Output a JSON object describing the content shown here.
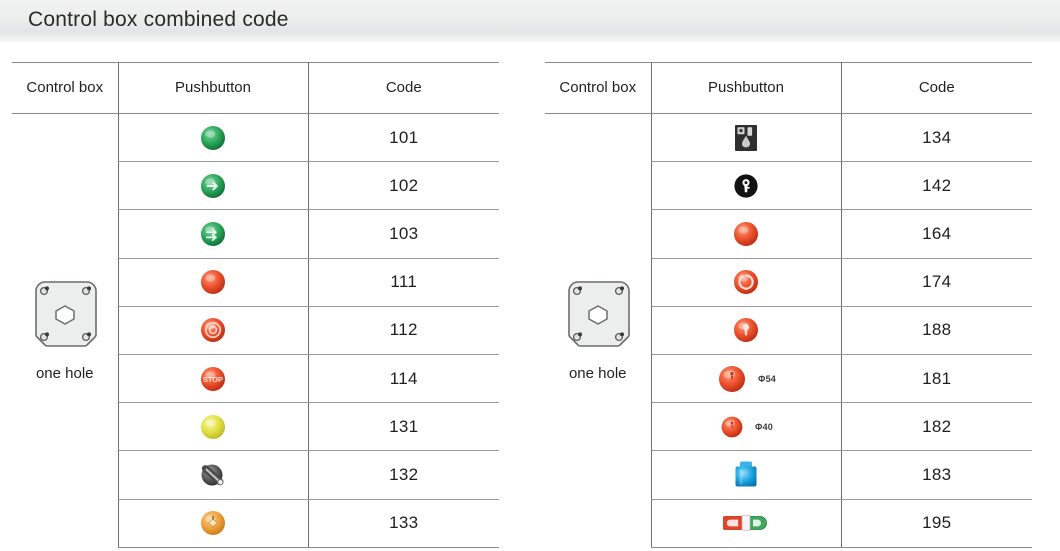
{
  "title": "Control box combined code",
  "colors": {
    "title_band": "#ececed",
    "rule": "#8a8a8a",
    "green": "#1f9a4d",
    "red": "#e8442a",
    "yellow": "#e3e03a",
    "orange": "#eda13a",
    "blue": "#1aa3e0",
    "dark": "#3a3a3a"
  },
  "tables": [
    {
      "id": "left",
      "headers": {
        "control_box": "Control box",
        "pushbutton": "Pushbutton",
        "code": "Code"
      },
      "control_box": {
        "icon": "enclosure-one-hole-icon",
        "caption": "one hole"
      },
      "rows": [
        {
          "icon": "green-round-button-icon",
          "color": "green",
          "label": "",
          "code": "101"
        },
        {
          "icon": "green-arrow-right-button-icon",
          "color": "green",
          "label": "",
          "code": "102"
        },
        {
          "icon": "green-double-arrow-button-icon",
          "color": "green",
          "label": "",
          "code": "103"
        },
        {
          "icon": "red-round-button-icon",
          "color": "red",
          "label": "",
          "code": "111"
        },
        {
          "icon": "red-ring-button-icon",
          "color": "red",
          "label": "",
          "code": "112"
        },
        {
          "icon": "red-stop-text-button-icon",
          "color": "red",
          "label": "",
          "code": "114"
        },
        {
          "icon": "yellow-round-button-icon",
          "color": "yellow",
          "label": "",
          "code": "131"
        },
        {
          "icon": "dark-selector-switch-icon",
          "color": "dark",
          "label": "",
          "code": "132"
        },
        {
          "icon": "orange-selector-button-icon",
          "color": "orange",
          "label": "",
          "code": "133"
        }
      ]
    },
    {
      "id": "right",
      "headers": {
        "control_box": "Control box",
        "pushbutton": "Pushbutton",
        "code": "Code"
      },
      "control_box": {
        "icon": "enclosure-one-hole-icon",
        "caption": "one hole"
      },
      "rows": [
        {
          "icon": "dark-square-selector-icon",
          "color": "dark",
          "label": "",
          "code": "134"
        },
        {
          "icon": "black-key-switch-icon",
          "color": "dark",
          "label": "",
          "code": "142"
        },
        {
          "icon": "red-mushroom-button-icon",
          "color": "red",
          "label": "",
          "code": "164"
        },
        {
          "icon": "red-twist-release-button-icon",
          "color": "red",
          "label": "",
          "code": "174"
        },
        {
          "icon": "red-key-release-button-icon",
          "color": "red",
          "label": "",
          "code": "188"
        },
        {
          "icon": "red-mushroom-large-button-icon",
          "color": "red",
          "label": "Φ54",
          "code": "181"
        },
        {
          "icon": "red-mushroom-small-button-icon",
          "color": "red",
          "label": "Φ40",
          "code": "182"
        },
        {
          "icon": "blue-rectangular-button-icon",
          "color": "blue",
          "label": "",
          "code": "183"
        },
        {
          "icon": "red-green-dual-rocker-icon",
          "color": "red",
          "label": "",
          "code": "195"
        }
      ]
    }
  ]
}
